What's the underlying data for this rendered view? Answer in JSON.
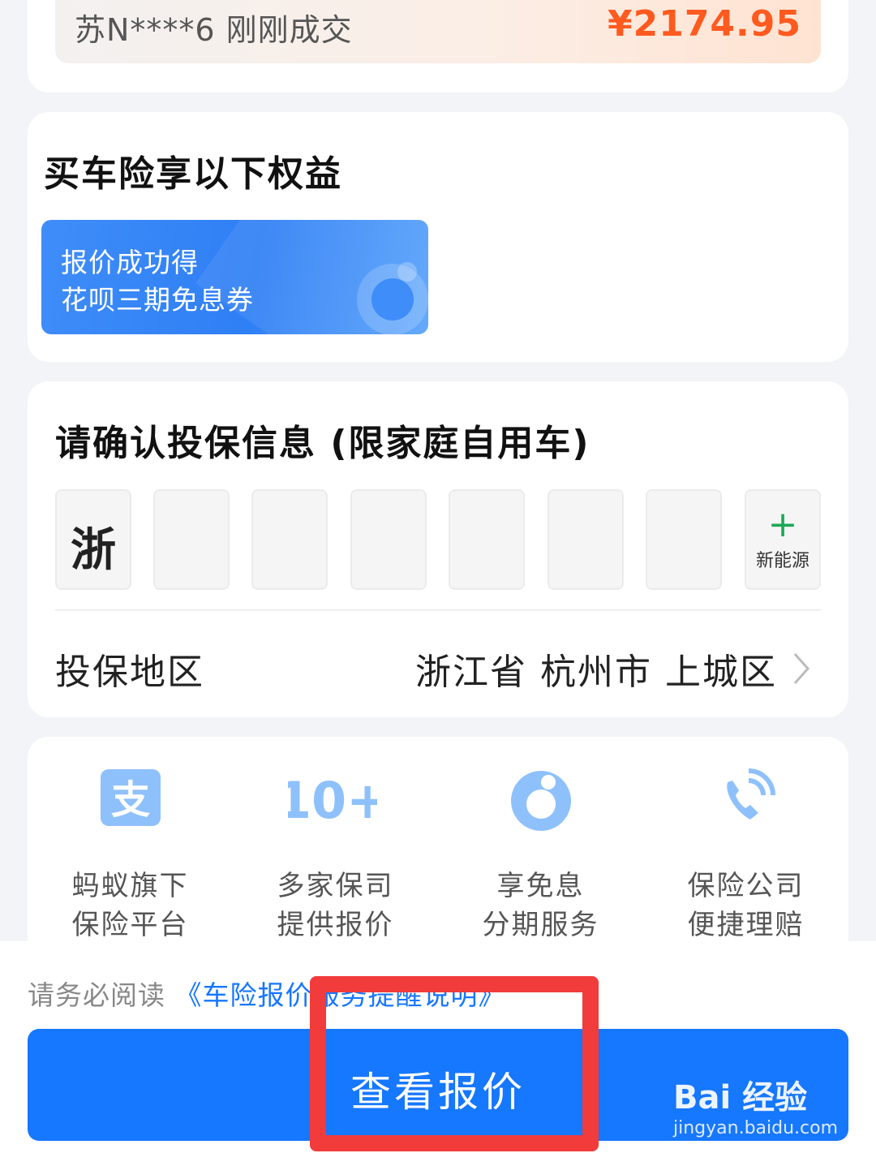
{
  "deal": {
    "text": "苏N****6 刚刚成交",
    "price": "¥2174.95"
  },
  "benefits": {
    "title": "买车险享以下权益",
    "coupon_line1": "报价成功得",
    "coupon_line2": "花呗三期免息券"
  },
  "info": {
    "title": "请确认投保信息 (限家庭自用车)",
    "plate": {
      "province": "浙",
      "slots": [
        "",
        "",
        "",
        "",
        "",
        ""
      ],
      "new_energy_label": "新能源"
    },
    "region_label": "投保地区",
    "region_value": "浙江省 杭州市 上城区"
  },
  "features": [
    {
      "icon": "alipay-icon",
      "line1": "蚂蚁旗下",
      "line2": "保险平台"
    },
    {
      "icon": "ten-plus-icon",
      "line1": "多家保司",
      "line2": "提供报价"
    },
    {
      "icon": "huabei-icon",
      "line1": "享免息",
      "line2": "分期服务"
    },
    {
      "icon": "phone-icon",
      "line1": "保险公司",
      "line2": "便捷理赔"
    }
  ],
  "bottom": {
    "notice_prefix": "请务必阅读",
    "notice_link": "《车险报价服务提醒说明》",
    "cta_label": "查看报价"
  },
  "watermark": {
    "brand": "Bai 经验",
    "url": "jingyan.baidu.com"
  },
  "colors": {
    "primary": "#1677ff",
    "price": "#ff5a1f",
    "highlight": "#f23b3b",
    "new_energy": "#1aaa55"
  }
}
